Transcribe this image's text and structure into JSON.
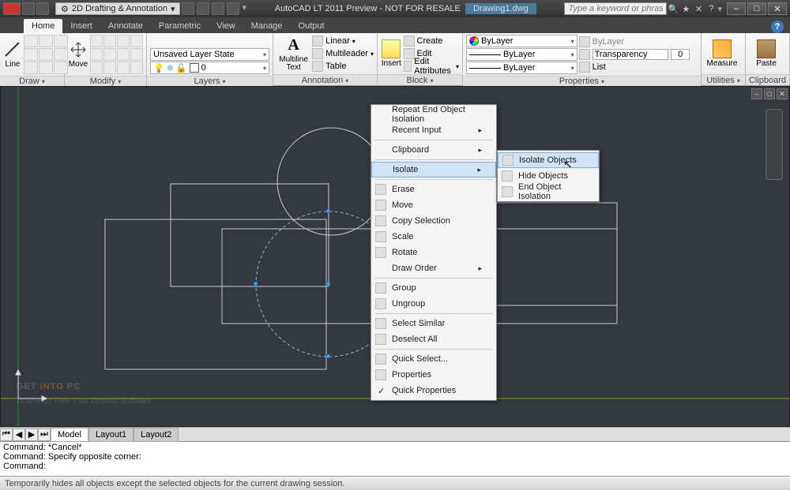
{
  "titlebar": {
    "workspace": "2D Drafting & Annotation",
    "app_title": "AutoCAD LT 2011 Preview - NOT FOR RESALE",
    "doc_title": "Drawing1.dwg",
    "search_placeholder": "Type a keyword or phrase"
  },
  "ribbon_tabs": [
    "Home",
    "Insert",
    "Annotate",
    "Parametric",
    "View",
    "Manage",
    "Output"
  ],
  "panels": {
    "draw": {
      "title": "Draw",
      "big": "Line"
    },
    "modify": {
      "title": "Modify",
      "big": "Move"
    },
    "layers": {
      "title": "Layers",
      "state": "Unsaved Layer State",
      "layer0": "0"
    },
    "annotation": {
      "title": "Annotation",
      "big": "Multiline Text",
      "r1": "Linear",
      "r2": "Multileader",
      "r3": "Table"
    },
    "block": {
      "title": "Block",
      "big": "Insert",
      "r1": "Create",
      "r2": "Edit",
      "r3": "Edit Attributes"
    },
    "properties": {
      "title": "Properties",
      "color": "ByLayer",
      "linetype": "ByLayer",
      "linetype2": "ByLayer",
      "plotby": "ByLayer",
      "transp": "Transparency",
      "transp_val": "0",
      "list": "List"
    },
    "utilities": {
      "title": "Utilities",
      "big": "Measure"
    },
    "clipboard": {
      "title": "Clipboard",
      "big": "Paste"
    }
  },
  "context_menu": {
    "items": [
      {
        "label": "Repeat End Object Isolation"
      },
      {
        "label": "Recent Input",
        "sub": true
      },
      {
        "sep": true
      },
      {
        "label": "Clipboard",
        "sub": true
      },
      {
        "sep": true
      },
      {
        "label": "Isolate",
        "sub": true,
        "hl": true
      },
      {
        "sep": true
      },
      {
        "label": "Erase",
        "icon": true
      },
      {
        "label": "Move",
        "icon": true
      },
      {
        "label": "Copy Selection",
        "icon": true
      },
      {
        "label": "Scale",
        "icon": true
      },
      {
        "label": "Rotate",
        "icon": true
      },
      {
        "label": "Draw Order",
        "sub": true
      },
      {
        "sep": true
      },
      {
        "label": "Group",
        "icon": true
      },
      {
        "label": "Ungroup",
        "icon": true
      },
      {
        "sep": true
      },
      {
        "label": "Select Similar",
        "icon": true
      },
      {
        "label": "Deselect All",
        "icon": true
      },
      {
        "sep": true
      },
      {
        "label": "Quick Select...",
        "icon": true
      },
      {
        "label": "Properties",
        "icon": true
      },
      {
        "label": "Quick Properties",
        "check": true
      }
    ],
    "submenu": [
      {
        "label": "Isolate Objects",
        "hl": true
      },
      {
        "label": "Hide Objects"
      },
      {
        "label": "End Object Isolation"
      }
    ]
  },
  "draw_tabs": [
    "Model",
    "Layout1",
    "Layout2"
  ],
  "cmd": {
    "l1": "Command: *Cancel*",
    "l2": "Command: Specify opposite corner:",
    "l3": "Command:"
  },
  "status_msg": "Temporarily hides all objects except the selected objects for the current drawing session.",
  "watermark": {
    "g": "GET ",
    "i": "INTO ",
    "p": "PC",
    "sub": "Download Free Your Desired Software"
  }
}
